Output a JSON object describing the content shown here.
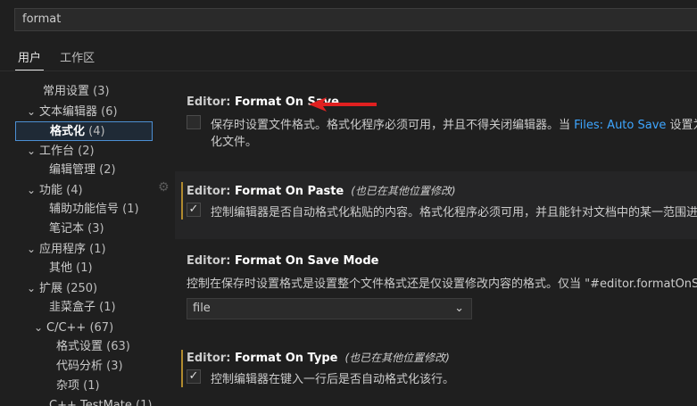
{
  "search": {
    "value": "format"
  },
  "tabs": [
    {
      "label": "用户",
      "active": true
    },
    {
      "label": "工作区",
      "active": false
    }
  ],
  "tree": [
    {
      "label": "常用设置",
      "count": "(3)",
      "chevron": ""
    },
    {
      "label": "文本编辑器",
      "count": "(6)",
      "chevron": "v"
    },
    {
      "label": "格式化",
      "count": "(4)",
      "chevron": "",
      "selected": true
    },
    {
      "label": "工作台",
      "count": "(2)",
      "chevron": "v"
    },
    {
      "label": "编辑管理",
      "count": "(2)",
      "chevron": ""
    },
    {
      "label": "功能",
      "count": "(4)",
      "chevron": "v"
    },
    {
      "label": "辅助功能信号",
      "count": "(1)",
      "chevron": ""
    },
    {
      "label": "笔记本",
      "count": "(3)",
      "chevron": ""
    },
    {
      "label": "应用程序",
      "count": "(1)",
      "chevron": "v"
    },
    {
      "label": "其他",
      "count": "(1)",
      "chevron": ""
    },
    {
      "label": "扩展",
      "count": "(250)",
      "chevron": "v"
    },
    {
      "label": "韭菜盒子",
      "count": "(1)",
      "chevron": ""
    },
    {
      "label": "C/C++",
      "count": "(67)",
      "chevron": "v"
    },
    {
      "label": "格式设置",
      "count": "(63)",
      "chevron": ""
    },
    {
      "label": "代码分析",
      "count": "(3)",
      "chevron": ""
    },
    {
      "label": "杂项",
      "count": "(1)",
      "chevron": ""
    },
    {
      "label": "C++ TestMate",
      "count": "(1)",
      "chevron": ""
    }
  ],
  "settings": {
    "format_on_save": {
      "category": "Editor: ",
      "name": "Format On Save",
      "checked": false,
      "desc_before": "保存时设置文件格式。格式化程序必须可用，并且不得关闭编辑器。当 ",
      "desc_link": "Files: Auto Save",
      "desc_after": " 设置为",
      "desc_line2": "化文件。"
    },
    "format_on_paste": {
      "category": "Editor: ",
      "name": "Format On Paste",
      "modified": "(也已在其他位置修改)",
      "checked": true,
      "desc": "控制编辑器是否自动格式化粘贴的内容。格式化程序必须可用，并且能针对文档中的某一范围进"
    },
    "format_on_save_mode": {
      "category": "Editor: ",
      "name": "Format On Save Mode",
      "desc": "控制在保存时设置格式是设置整个文件格式还是仅设置修改内容的格式。仅当 \"#editor.formatOnSav",
      "value": "file"
    },
    "format_on_type": {
      "category": "Editor: ",
      "name": "Format On Type",
      "modified": "(也已在其他位置修改)",
      "checked": true,
      "desc": "控制编辑器在键入一行后是否自动格式化该行。"
    }
  },
  "colors": {
    "accent": "#4c8fd3",
    "link": "#3ea6ff",
    "modified_bar": "#b08a2e",
    "arrow": "#e02020"
  }
}
